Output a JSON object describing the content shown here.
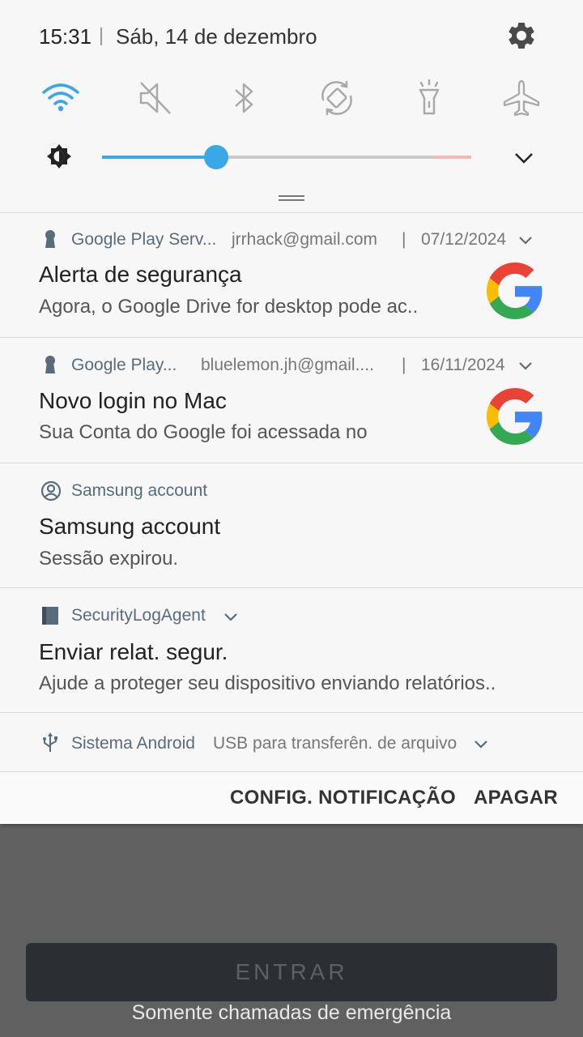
{
  "status": {
    "time": "15:31",
    "date": "Sáb, 14 de dezembro",
    "settings_icon": "gear-icon"
  },
  "quick_settings": {
    "toggles": [
      {
        "name": "wifi",
        "icon": "wifi-icon",
        "active": true
      },
      {
        "name": "sound",
        "icon": "mute-icon",
        "active": false
      },
      {
        "name": "bluetooth",
        "icon": "bluetooth-icon",
        "active": false
      },
      {
        "name": "auto-rotate",
        "icon": "rotate-icon",
        "active": false
      },
      {
        "name": "flashlight",
        "icon": "flashlight-icon",
        "active": false
      },
      {
        "name": "airplane",
        "icon": "airplane-icon",
        "active": false
      }
    ],
    "brightness": {
      "level": 0.31,
      "icon": "brightness-icon"
    },
    "accent": "#3aa8e6"
  },
  "notifications": [
    {
      "app": "Google Play Serv...",
      "account": "jrrhack@gmail.com",
      "date": "07/12/2024",
      "title": "Alerta de segurança",
      "text": "Agora, o Google Drive for desktop pode ac..",
      "icon": "keyhole-icon"
    },
    {
      "app": "Google Play...",
      "account": "bluelemon.jh@gmail....",
      "date": "16/11/2024",
      "title": "Novo login no Mac",
      "text": "Sua Conta do Google foi acessada no",
      "icon": "keyhole-icon"
    },
    {
      "app": "Samsung account",
      "title": "Samsung account",
      "text": "Sessão expirou.",
      "icon": "account-circle-icon"
    },
    {
      "app": "SecurityLogAgent",
      "title": "Enviar relat. segur.",
      "text": "Ajude a proteger seu dispositivo enviando relatórios..",
      "icon": "book-icon"
    },
    {
      "app": "Sistema Android",
      "text": "USB para transferên. de arquivo",
      "icon": "usb-icon"
    }
  ],
  "actions": {
    "config": "CONFIG. NOTIFICAÇÃO",
    "clear": "APAGAR"
  },
  "separator": "|",
  "lockscreen": {
    "enter": "ENTRAR",
    "emergency": "Somente chamadas de emergência"
  }
}
